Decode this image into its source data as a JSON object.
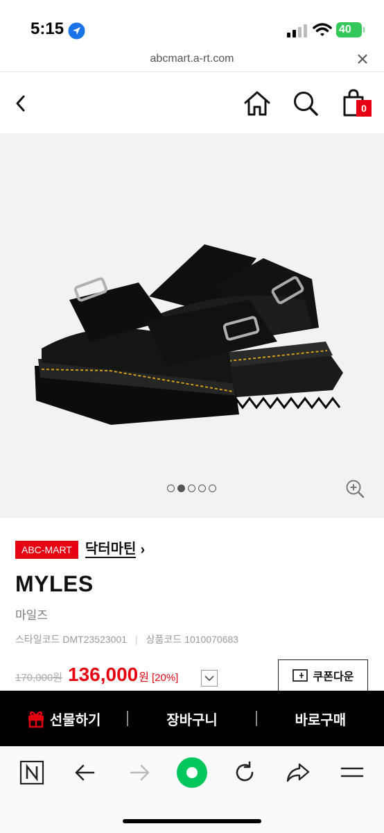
{
  "status_bar": {
    "time": "5:15",
    "battery": "40"
  },
  "url_bar": {
    "url": "abcmart.a-rt.com"
  },
  "header": {
    "cart_count": "0"
  },
  "gallery": {
    "image_alt": "black leather double-buckle platform slide sandals",
    "dot_count": 5,
    "active_dot": 1
  },
  "product": {
    "store_badge": "ABC-MART",
    "brand": "닥터마틴",
    "brand_chevron": "›",
    "name": "MYLES",
    "name_kr": "마일즈",
    "style_code_label": "스타일코드",
    "style_code": "DMT23523001",
    "product_code_label": "상품코드",
    "product_code": "1010070683",
    "original_price": "170,000원",
    "sale_price": "136,000",
    "price_unit": "원",
    "discount": "[20%]",
    "coupon_label": "쿠폰다운"
  },
  "actions": {
    "gift": "선물하기",
    "cart": "장바구니",
    "buy": "바로구매"
  },
  "colors": {
    "accent_red": "#e60012",
    "action_bar_bg": "#000000",
    "battery_green": "#34c759",
    "toolbar_green": "#03c75a"
  }
}
